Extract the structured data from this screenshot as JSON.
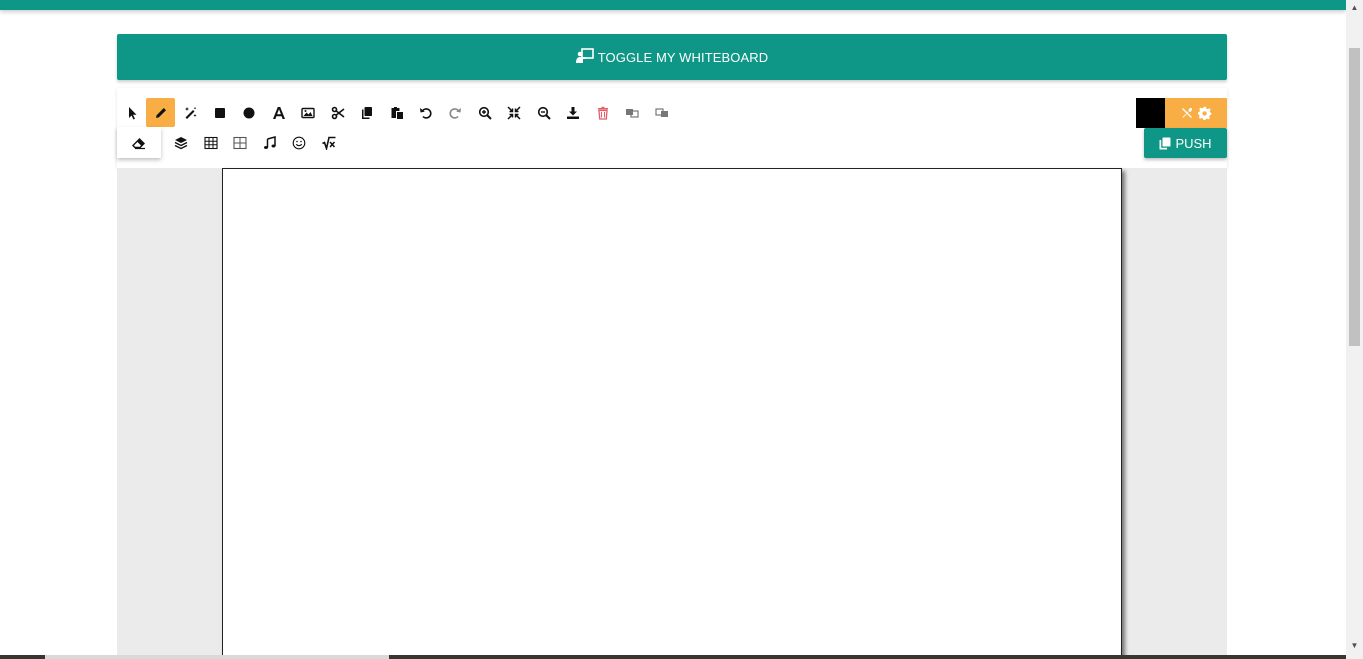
{
  "header": {
    "toggle_label": "TOGGLE MY WHITEBOARD",
    "accent_color": "#0e9686"
  },
  "toolbar": {
    "row1": [
      {
        "icon": "pointer-icon"
      },
      {
        "icon": "pencil-icon",
        "active": true
      },
      {
        "icon": "magic-wand-icon"
      },
      {
        "icon": "square-icon"
      },
      {
        "icon": "circle-icon"
      },
      {
        "icon": "text-icon"
      },
      {
        "icon": "image-icon"
      },
      {
        "icon": "scissors-icon"
      },
      {
        "icon": "copy-icon"
      },
      {
        "icon": "paste-icon"
      },
      {
        "icon": "undo-icon"
      },
      {
        "icon": "redo-icon"
      },
      {
        "icon": "zoom-in-icon"
      },
      {
        "icon": "compress-icon"
      },
      {
        "icon": "zoom-out-icon"
      },
      {
        "icon": "download-icon"
      },
      {
        "icon": "trash-icon"
      },
      {
        "icon": "bring-forward-icon"
      },
      {
        "icon": "send-backward-icon"
      }
    ],
    "row2": [
      {
        "icon": "eraser-icon"
      },
      {
        "icon": "layers-icon"
      },
      {
        "icon": "table-icon"
      },
      {
        "icon": "grid-icon"
      },
      {
        "icon": "music-note-icon"
      },
      {
        "icon": "smiley-icon"
      },
      {
        "icon": "square-root-icon"
      }
    ],
    "active_color": "#f8ad45",
    "stroke_color": "#000000",
    "push_label": "PUSH"
  }
}
